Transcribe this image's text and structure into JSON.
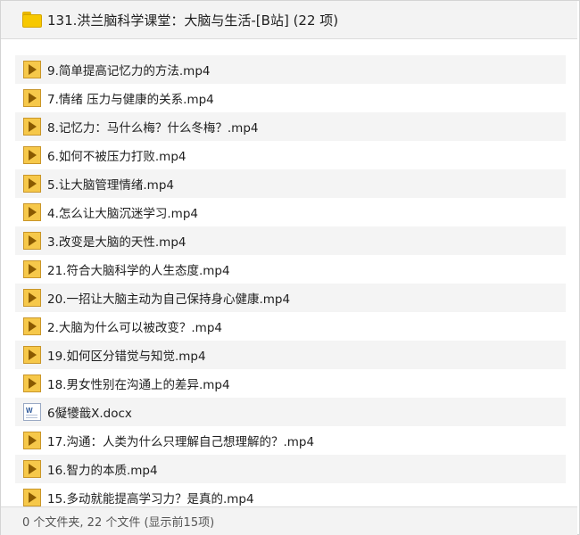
{
  "header": {
    "title": "131.洪兰脑科学课堂：大脑与生活-[B站] (22 项)",
    "icon": "folder-icon"
  },
  "files": [
    {
      "name": "9.简单提高记忆力的方法.mp4",
      "icon": "video-file-icon"
    },
    {
      "name": "7.情绪 压力与健康的关系.mp4",
      "icon": "video-file-icon"
    },
    {
      "name": "8.记忆力：马什么梅？什么冬梅？.mp4",
      "icon": "video-file-icon"
    },
    {
      "name": "6.如何不被压力打败.mp4",
      "icon": "video-file-icon"
    },
    {
      "name": "5.让大脑管理情绪.mp4",
      "icon": "video-file-icon"
    },
    {
      "name": "4.怎么让大脑沉迷学习.mp4",
      "icon": "video-file-icon"
    },
    {
      "name": "3.改变是大脑的天性.mp4",
      "icon": "video-file-icon"
    },
    {
      "name": "21.符合大脑科学的人生态度.mp4",
      "icon": "video-file-icon"
    },
    {
      "name": "20.一招让大脑主动为自己保持身心健康.mp4",
      "icon": "video-file-icon"
    },
    {
      "name": "2.大脑为什么可以被改变？.mp4",
      "icon": "video-file-icon"
    },
    {
      "name": "19.如何区分错觉与知觉.mp4",
      "icon": "video-file-icon"
    },
    {
      "name": "18.男女性别在沟通上的差异.mp4",
      "icon": "video-file-icon"
    },
    {
      "name": "6儗犪戠X.docx",
      "icon": "word-document-icon"
    },
    {
      "name": "17.沟通：人类为什么只理解自己想理解的？.mp4",
      "icon": "video-file-icon"
    },
    {
      "name": "16.智力的本质.mp4",
      "icon": "video-file-icon"
    },
    {
      "name": "15.多动就能提高学习力？是真的.mp4",
      "icon": "video-file-icon"
    }
  ],
  "footer": {
    "status": "0 个文件夹, 22 个文件 (显示前15项)"
  }
}
